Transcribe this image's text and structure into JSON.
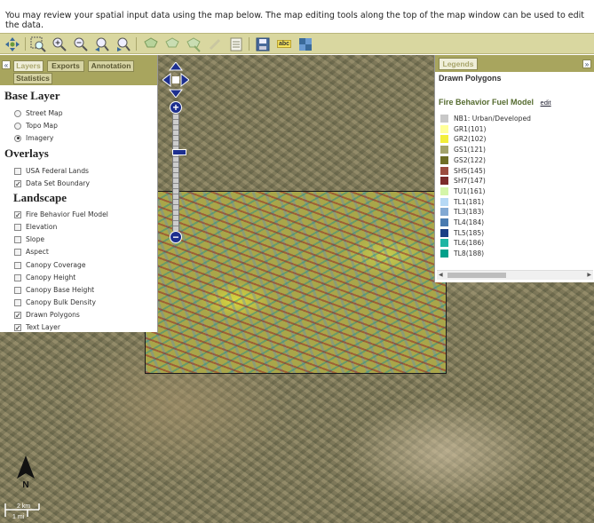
{
  "intro_text": "You may review your spatial input data using the map below. The map editing tools along the top of the map window can be used to edit the data.",
  "toolbar": {
    "tools": [
      "pan-icon",
      "zoom-extent-icon",
      "zoom-in-icon",
      "zoom-out-icon",
      "zoom-previous-icon",
      "zoom-next-icon",
      "draw-polygon-icon",
      "edit-polygon-icon",
      "delete-polygon-icon",
      "pencil-icon",
      "attribute-table-icon",
      "save-icon",
      "label-icon",
      "layers-icon"
    ],
    "label_tool_text": "abc"
  },
  "layers_panel": {
    "collapse_glyph": "«",
    "tabs": [
      "Layers",
      "Exports",
      "Annotation",
      "Statistics"
    ],
    "active_tab": "Layers",
    "base_layer": {
      "title": "Base Layer",
      "options": [
        {
          "label": "Street Map",
          "selected": false
        },
        {
          "label": "Topo Map",
          "selected": false
        },
        {
          "label": "Imagery",
          "selected": true
        }
      ]
    },
    "overlays": {
      "title": "Overlays",
      "options": [
        {
          "label": "USA Federal Lands",
          "checked": false
        },
        {
          "label": "Data Set Boundary",
          "checked": true
        }
      ]
    },
    "landscape": {
      "title": "Landscape",
      "options": [
        {
          "label": "Fire Behavior Fuel Model",
          "checked": true
        },
        {
          "label": "Elevation",
          "checked": false
        },
        {
          "label": "Slope",
          "checked": false
        },
        {
          "label": "Aspect",
          "checked": false
        },
        {
          "label": "Canopy Coverage",
          "checked": false
        },
        {
          "label": "Canopy Height",
          "checked": false
        },
        {
          "label": "Canopy Base Height",
          "checked": false
        },
        {
          "label": "Canopy Bulk Density",
          "checked": false
        },
        {
          "label": "Drawn Polygons",
          "checked": true
        },
        {
          "label": "Text Layer",
          "checked": true
        }
      ]
    }
  },
  "legend_panel": {
    "tab": "Legends",
    "close_glyph": "»",
    "title": "Drawn Polygons",
    "subtitle": "Fire Behavior Fuel Model",
    "edit_label": "edit",
    "items": [
      {
        "label": "NB1: Urban/Developed",
        "color": "#c8c8c8"
      },
      {
        "label": "GR1(101)",
        "color": "#ffff99"
      },
      {
        "label": "GR2(102)",
        "color": "#f2ee3a"
      },
      {
        "label": "GS1(121)",
        "color": "#a3a36a"
      },
      {
        "label": "GS2(122)",
        "color": "#6e6e25"
      },
      {
        "label": "SH5(145)",
        "color": "#9b4b3e"
      },
      {
        "label": "SH7(147)",
        "color": "#7a2a2a"
      },
      {
        "label": "TU1(161)",
        "color": "#d4f5a9"
      },
      {
        "label": "TL1(181)",
        "color": "#b6d9f5"
      },
      {
        "label": "TL3(183)",
        "color": "#82a9d3"
      },
      {
        "label": "TL4(184)",
        "color": "#4a7bb0"
      },
      {
        "label": "TL5(185)",
        "color": "#1a3f85"
      },
      {
        "label": "TL6(186)",
        "color": "#1fb5a3"
      },
      {
        "label": "TL8(188)",
        "color": "#00a08a"
      }
    ]
  },
  "map": {
    "north_label": "N",
    "scale_km": "2 km",
    "scale_mi": "1 mi"
  }
}
